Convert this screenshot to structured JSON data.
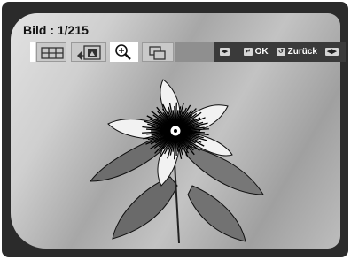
{
  "header": {
    "title": "Bild : 1/215"
  },
  "controls": {
    "nav_icon": "left-right-arrows-icon",
    "ok_icon": "enter-icon",
    "ok_label": "OK",
    "back_icon": "return-icon",
    "back_label": "Zurück",
    "skip_icon": "skip-back-forward-icon"
  },
  "toolbar_icons": [
    "grid-view-icon",
    "slideshow-icon",
    "zoom-icon",
    "copy-icon"
  ],
  "colors": {
    "frame": "#2b2b2b",
    "bar": "#3a3a3a",
    "spacer": "#8f8f8f"
  }
}
